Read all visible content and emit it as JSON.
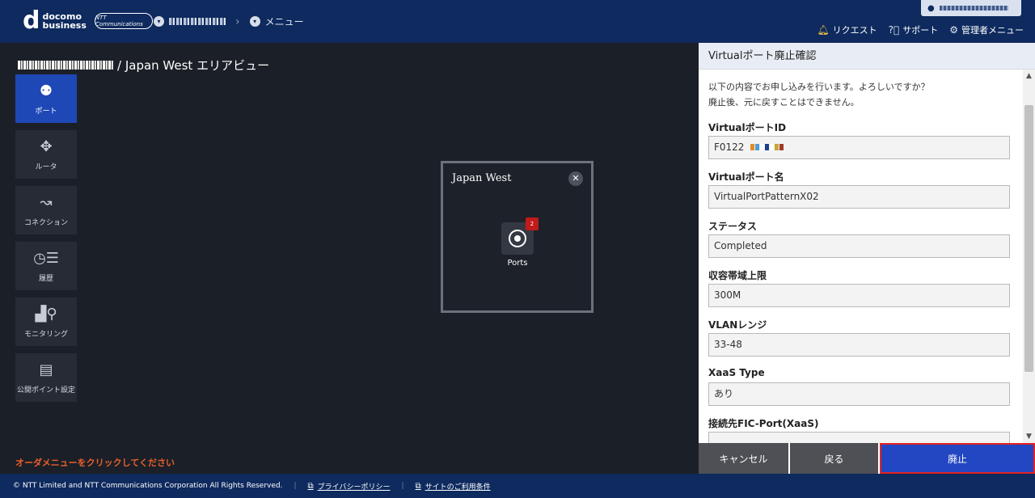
{
  "header": {
    "logo_mark": "d",
    "logo_line1": "docomo",
    "logo_line2": "business",
    "logo_partner": "NTT Communications",
    "menu_label": "メニュー",
    "request_label": "リクエスト",
    "support_label": "サポート",
    "admin_menu_label": "管理者メニュー",
    "icons": {
      "bell": "bell-icon",
      "help": "help-icon",
      "gear": "gear-icon",
      "user": "user-icon"
    }
  },
  "page": {
    "title_suffix": "/ Japan West エリアビュー"
  },
  "nav": {
    "items": [
      {
        "label": "ポート",
        "icon": "port-icon"
      },
      {
        "label": "ルータ",
        "icon": "router-icon"
      },
      {
        "label": "コネクション",
        "icon": "connection-icon"
      },
      {
        "label": "履歴",
        "icon": "history-icon"
      },
      {
        "label": "モニタリング",
        "icon": "monitoring-icon"
      },
      {
        "label": "公開ポイント設定",
        "icon": "public-point-icon"
      }
    ]
  },
  "order_message": "オーダメニューをクリックしてください",
  "region": {
    "title": "Japan West",
    "ports_label": "Ports",
    "ports_badge": "2"
  },
  "panel": {
    "title": "Virtualポート廃止確認",
    "message_line1": "以下の内容でお申し込みを行います。よろしいですか？",
    "message_line2": "廃止後、元に戻すことはできません。",
    "fields": [
      {
        "label": "VirtualポートID",
        "value": "F0122"
      },
      {
        "label": "Virtualポート名",
        "value": "VirtualPortPatternX02"
      },
      {
        "label": "ステータス",
        "value": "Completed"
      },
      {
        "label": "収容帯域上限",
        "value": "300M"
      },
      {
        "label": "VLANレンジ",
        "value": "33-48"
      },
      {
        "label": "XaaS Type",
        "value": "あり"
      },
      {
        "label": "接続先FIC-Port(XaaS)",
        "value": ""
      }
    ],
    "cancel_label": "キャンセル",
    "back_label": "戻る",
    "delete_label": "廃止"
  },
  "footer": {
    "copyright": "© NTT Limited and NTT Communications Corporation All Rights Reserved.",
    "privacy_label": "プライバシーポリシー",
    "terms_label": "サイトのご利用条件"
  },
  "colors": {
    "header_bg": "#0e2a5e",
    "accent_blue": "#2347c2",
    "highlight_red": "#e52222",
    "order_orange": "#e8602c"
  }
}
